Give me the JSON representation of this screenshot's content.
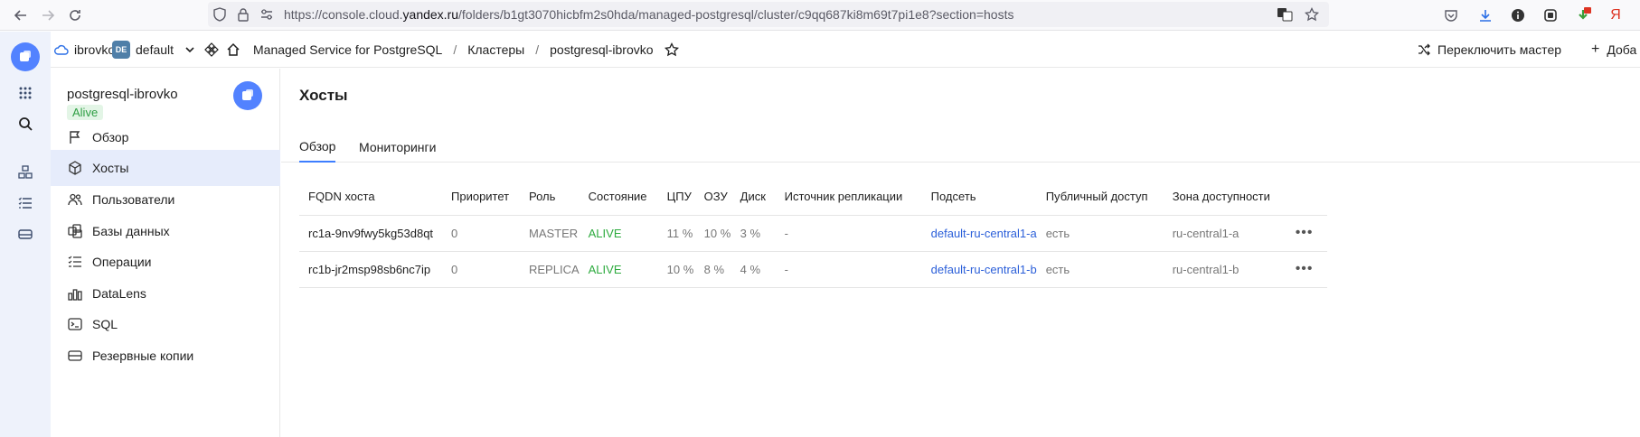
{
  "browser": {
    "url_prefix": "https://console.cloud.",
    "url_domain": "yandex.ru",
    "url_suffix": "/folders/b1gt3070hicbfm2s0hda/managed-postgresql/cluster/c9qq687ki8m69t7pi1e8?section=hosts",
    "yandex_glyph": "Я"
  },
  "header": {
    "cloud": "ibrovko",
    "folder_badge": "DE",
    "folder": "default",
    "service": "Managed Service for PostgreSQL",
    "sep1": "/",
    "clusters": "Кластеры",
    "sep2": "/",
    "cluster": "postgresql-ibrovko",
    "switch_master": "Переключить мастер",
    "add": "Доба"
  },
  "sidebar": {
    "cluster_name": "postgresql-ibrovko",
    "status": "Alive",
    "items": [
      {
        "label": "Обзор"
      },
      {
        "label": "Хосты"
      },
      {
        "label": "Пользователи"
      },
      {
        "label": "Базы данных"
      },
      {
        "label": "Операции"
      },
      {
        "label": "DataLens"
      },
      {
        "label": "SQL"
      },
      {
        "label": "Резервные копии"
      }
    ]
  },
  "main": {
    "title": "Хосты",
    "tabs": [
      {
        "label": "Обзор"
      },
      {
        "label": "Мониторинги"
      }
    ],
    "columns": [
      "FQDN хоста",
      "Приоритет",
      "Роль",
      "Состояние",
      "ЦПУ",
      "ОЗУ",
      "Диск",
      "Источник репликации",
      "Подсеть",
      "Публичный доступ",
      "Зона доступности"
    ],
    "rows": [
      {
        "fqdn": "rc1a-9nv9fwy5kg53d8qt",
        "priority": "0",
        "role": "MASTER",
        "state": "ALIVE",
        "cpu": "11 %",
        "ram": "10 %",
        "disk": "3 %",
        "source": "-",
        "subnet": "default-ru-central1-a",
        "public": "есть",
        "zone": "ru-central1-a",
        "menu": "•••"
      },
      {
        "fqdn": "rc1b-jr2msp98sb6nc7ip",
        "priority": "0",
        "role": "REPLICA",
        "state": "ALIVE",
        "cpu": "10 %",
        "ram": "8 %",
        "disk": "4 %",
        "source": "-",
        "subnet": "default-ru-central1-b",
        "public": "есть",
        "zone": "ru-central1-b",
        "menu": "•••"
      }
    ]
  }
}
